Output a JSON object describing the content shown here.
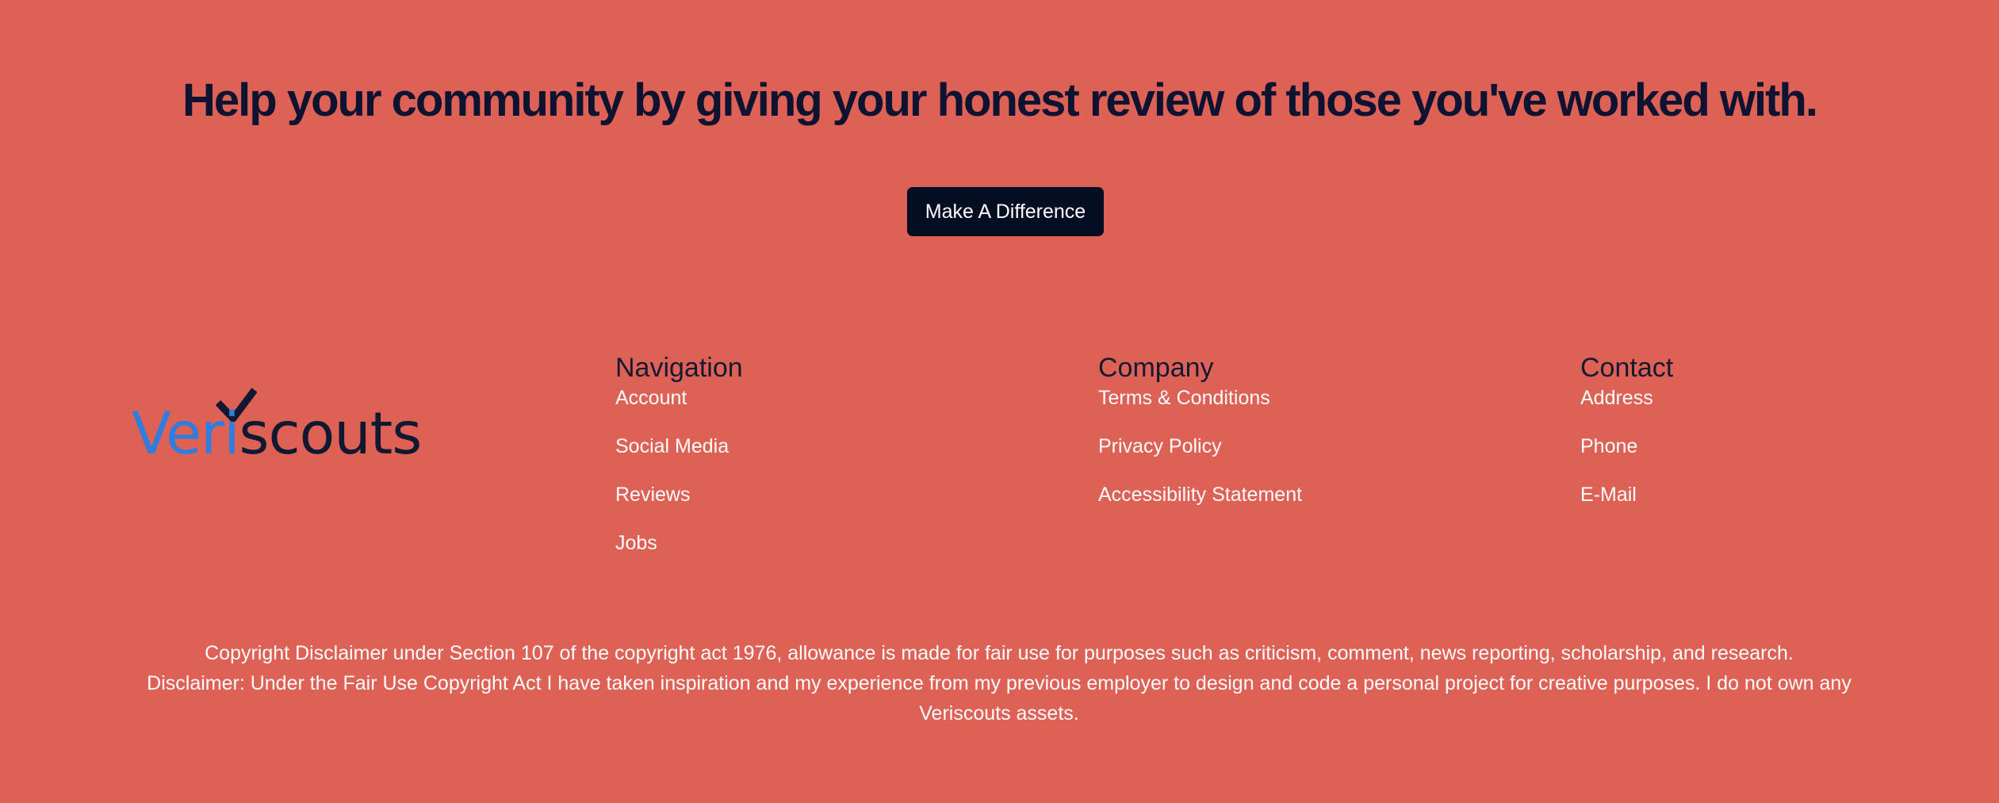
{
  "hero": {
    "title": "Help your community by giving your honest review of those you've worked with.",
    "cta_label": "Make A Difference"
  },
  "logo": {
    "part1": "Veri",
    "part2": "scouts",
    "check_icon": "check-mark-icon"
  },
  "footer": {
    "navigation": {
      "heading": "Navigation",
      "links": [
        "Account",
        "Social Media",
        "Reviews",
        "Jobs"
      ]
    },
    "company": {
      "heading": "Company",
      "links": [
        "Terms & Conditions",
        "Privacy Policy",
        "Accessibility Statement"
      ]
    },
    "contact": {
      "heading": "Contact",
      "links": [
        "Address",
        "Phone",
        "E-Mail"
      ]
    }
  },
  "disclaimer": {
    "line1": "Copyright Disclaimer under Section 107 of the copyright act 1976, allowance is made for fair use for purposes such as criticism, comment, news reporting, scholarship, and research.",
    "line2": "Disclaimer: Under the Fair Use Copyright Act I have taken inspiration and my experience from my previous employer to design and code a personal project for creative purposes. I do not own any Veriscouts assets."
  },
  "colors": {
    "background": "#de6155",
    "heading": "#0d1330",
    "button_bg": "#030e23",
    "logo_blue": "#2f7de1",
    "logo_dark": "#111832",
    "link": "#ffffff"
  }
}
